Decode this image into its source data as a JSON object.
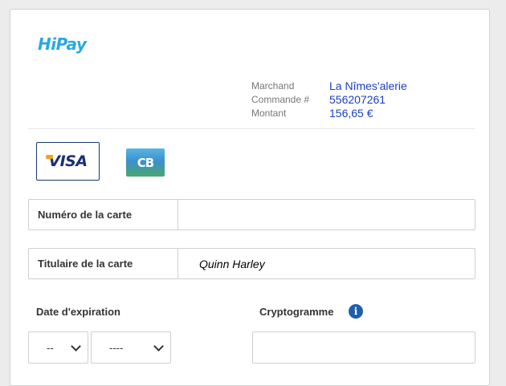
{
  "brand": {
    "logo_text": "HiPay",
    "logo_color": "#29a9e1"
  },
  "order_summary": {
    "merchant_label": "Marchand",
    "merchant_value": "La Nîmes'alerie",
    "order_label": "Commande #",
    "order_value": "556207261",
    "amount_label": "Montant",
    "amount_value": "156,65 €"
  },
  "payment_methods": [
    {
      "label": "VISA",
      "icon": "visa-logo",
      "selected": true
    },
    {
      "label": "CB",
      "icon": "cb-logo",
      "selected": false
    }
  ],
  "form": {
    "card_number_label": "Numéro de la carte",
    "card_number_value": "",
    "cardholder_label": "Titulaire de la carte",
    "cardholder_value": "Quinn Harley",
    "expiry_label": "Date d'expiration",
    "expiry_month_selected": "--",
    "expiry_year_selected": "----",
    "cvv_label": "Cryptogramme",
    "cvv_info_icon": "info-icon",
    "cvv_value": ""
  },
  "colors": {
    "accent": "#1a3fbf",
    "info": "#1e5fa8",
    "visa_navy": "#1a2f7a"
  }
}
